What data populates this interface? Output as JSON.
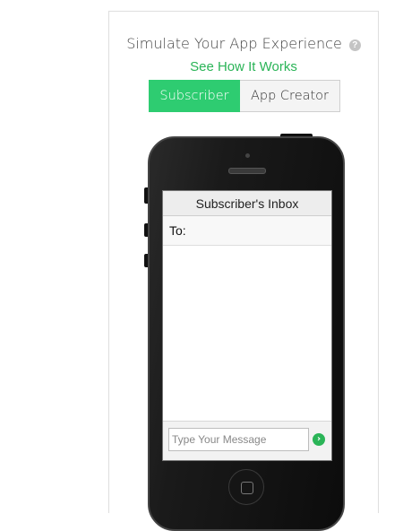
{
  "header": {
    "title": "Simulate Your App Experience",
    "help_icon": "question-circle-icon",
    "link_label": "See How It Works"
  },
  "toggle": {
    "tabs": [
      {
        "label": "Subscriber",
        "active": true
      },
      {
        "label": "App Creator",
        "active": false
      }
    ]
  },
  "phone": {
    "inbox_title": "Subscriber's Inbox",
    "to_label": "To:",
    "message_placeholder": "Type Your Message",
    "send_icon": "send-arrow-icon",
    "home_icon": "home-button-icon"
  },
  "colors": {
    "accent_green": "#2ecc71",
    "link_green": "#2ab457"
  }
}
